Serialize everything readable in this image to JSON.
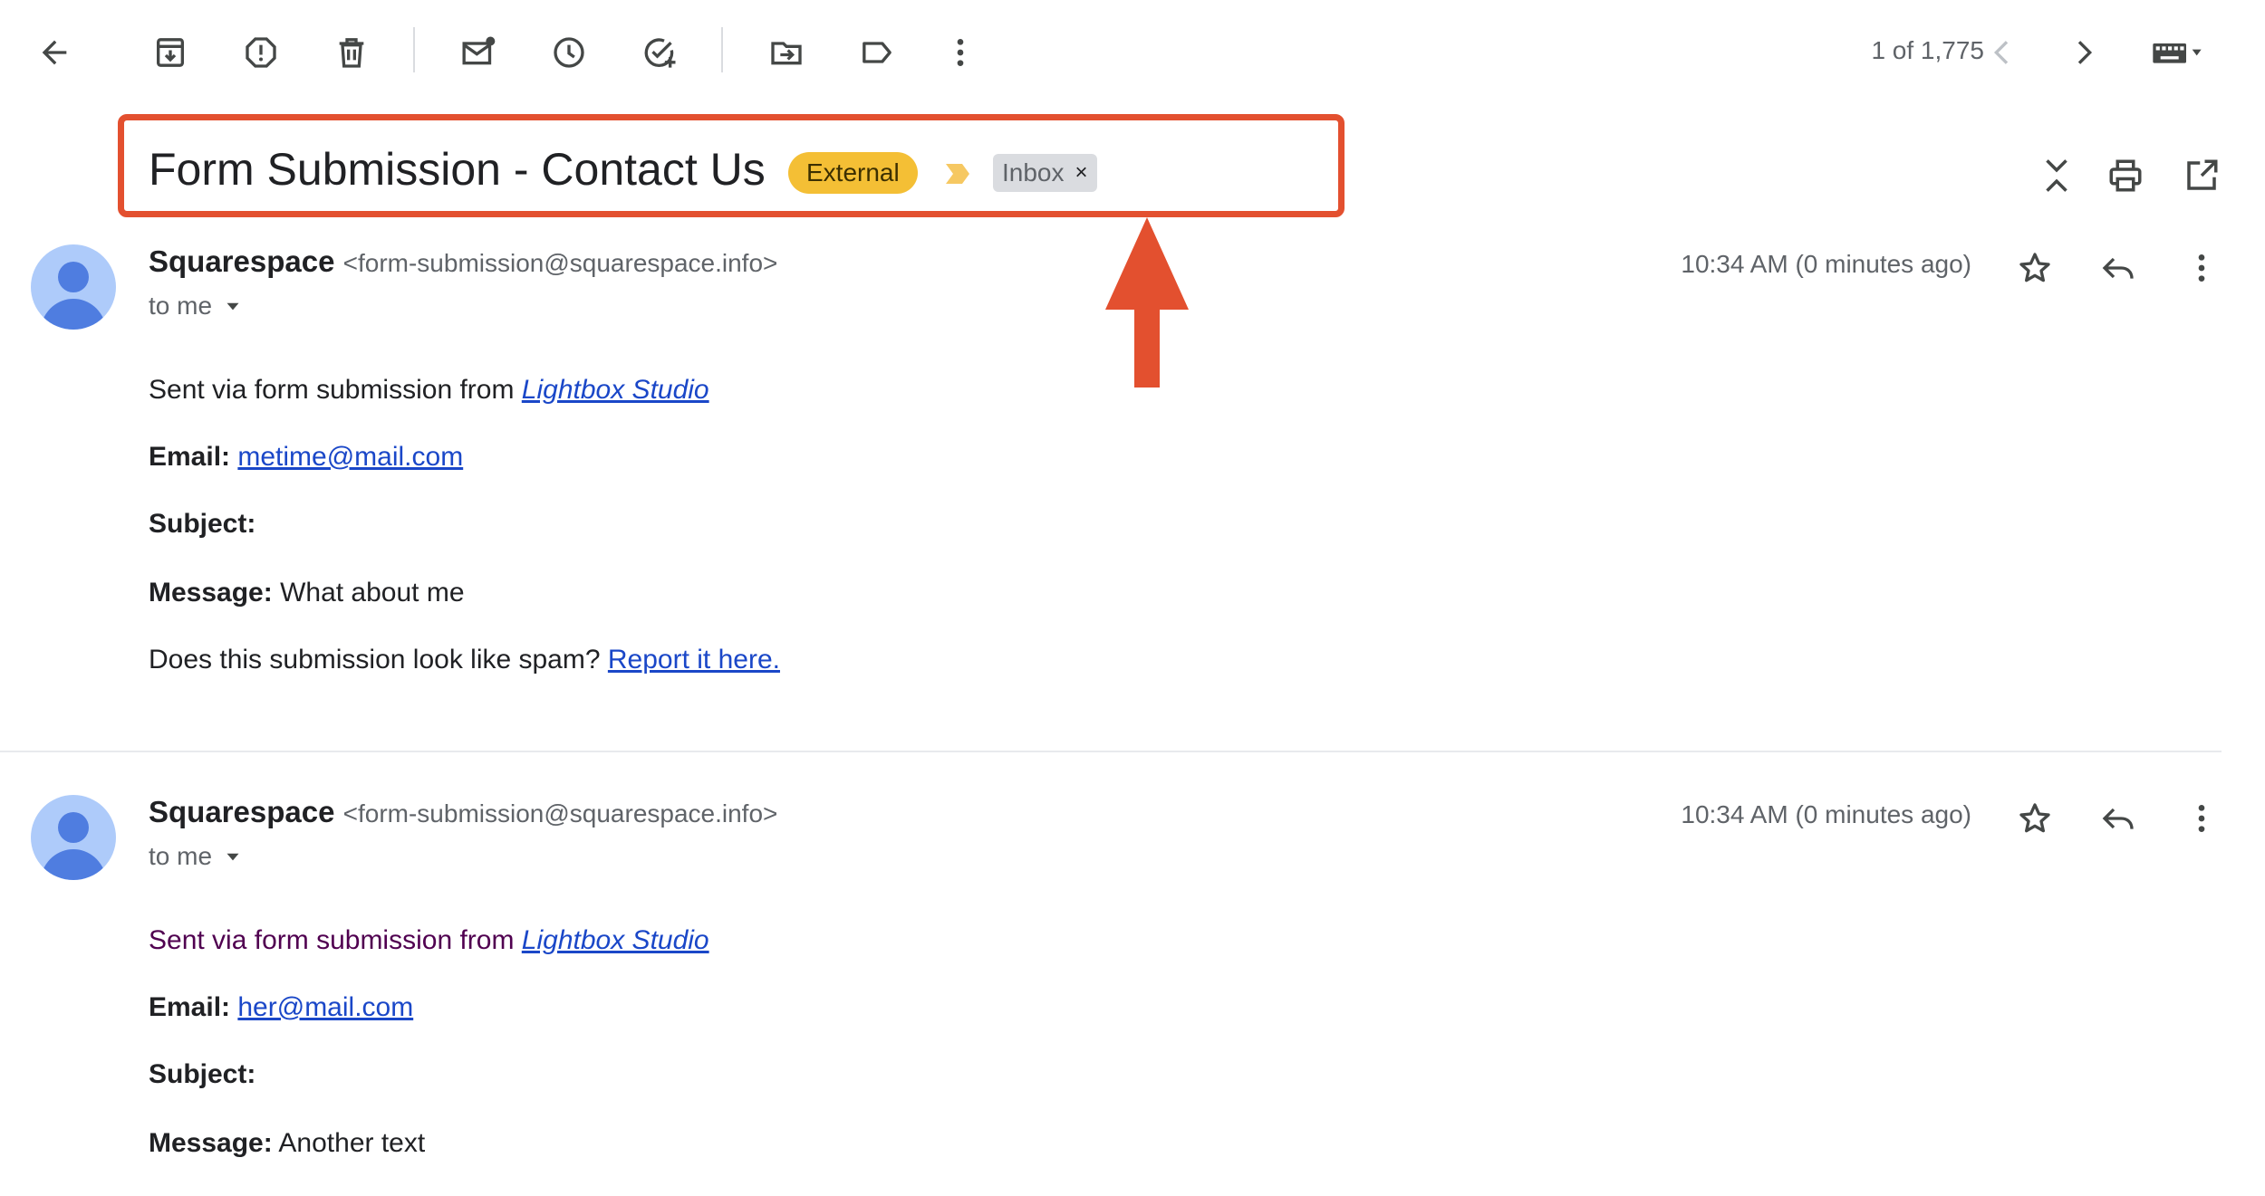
{
  "toolbar": {
    "icons": [
      "back-arrow-icon",
      "archive-icon",
      "report-spam-icon",
      "delete-icon",
      "mark-unread-icon",
      "snooze-icon",
      "add-task-icon",
      "move-to-icon",
      "label-icon",
      "more-vert-icon"
    ],
    "pager": "1 of 1,775"
  },
  "thread": {
    "subject": "Form Submission - Contact Us",
    "label_external": "External",
    "label_inbox": "Inbox",
    "label_inbox_remove": "×"
  },
  "messages": [
    {
      "sender_name": "Squarespace",
      "sender_email": "<form-submission@squarespace.info>",
      "to": "to me",
      "time": "10:34 AM (0 minutes ago)",
      "intro_text": "Sent via form submission from ",
      "intro_link": "Lightbox Studio",
      "email_label": "Email:",
      "email_value": "metime@mail.com",
      "subject_label": "Subject:",
      "message_label": "Message:",
      "message_value": " What about me",
      "spam_text": "Does this submission look like spam? ",
      "spam_link": "Report it here."
    },
    {
      "sender_name": "Squarespace",
      "sender_email": "<form-submission@squarespace.info>",
      "to": "to me",
      "time": "10:34 AM (0 minutes ago)",
      "intro_text": "Sent via form submission from ",
      "intro_link": "Lightbox Studio",
      "email_label": "Email:",
      "email_value": "her@mail.com",
      "subject_label": "Subject:",
      "message_label": "Message:",
      "message_value": " Another text"
    }
  ],
  "colors": {
    "highlight": "#e3502f",
    "external_badge": "#f4bf35",
    "link": "#1a47c8",
    "avatar": "#aecbfa"
  }
}
